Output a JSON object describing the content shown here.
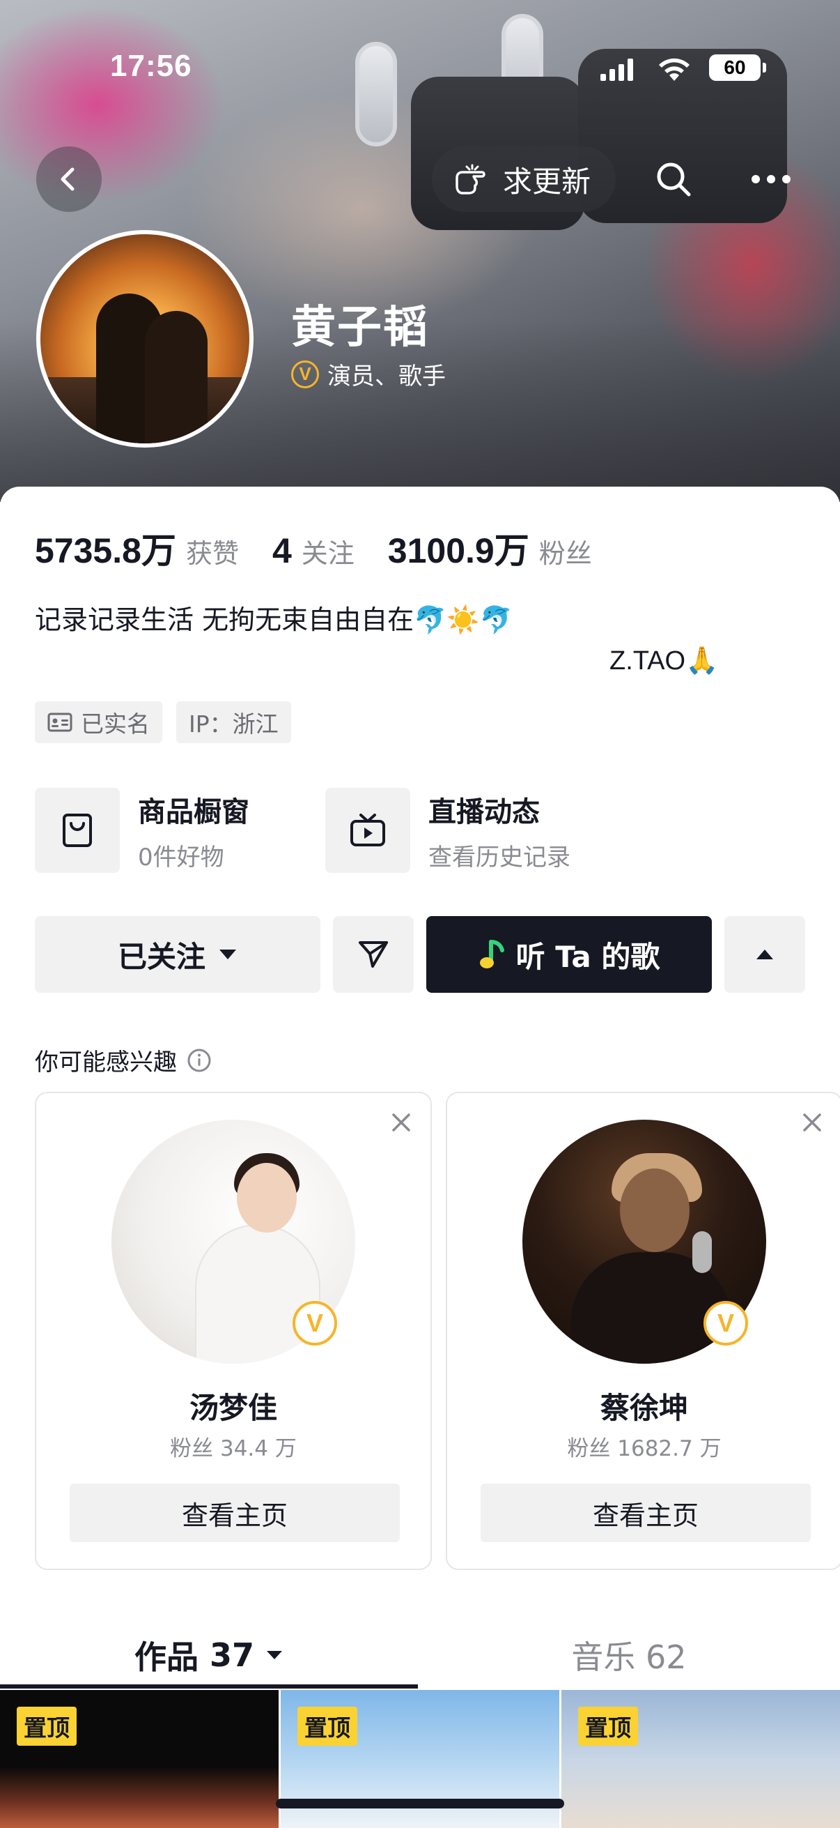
{
  "status_bar": {
    "time": "17:56",
    "battery": "60"
  },
  "header": {
    "back_icon": "chevron-left-icon",
    "request_update_label": "求更新",
    "search_icon": "search-icon",
    "more_icon": "more-dots-icon"
  },
  "profile": {
    "name": "黄子韬",
    "verified_badge": "V",
    "verified_label": "演员、歌手",
    "badge_color": "#F5B52B"
  },
  "stats": {
    "likes_value": "5735.8万",
    "likes_label": "获赞",
    "following_value": "4",
    "following_label": "关注",
    "fans_value": "3100.9万",
    "fans_label": "粉丝"
  },
  "bio": {
    "line1": "记录记录生活 无拘无束自由自在🐬☀️🐬",
    "line2": "Z.TAO🙏"
  },
  "tags": {
    "realname": "已实名",
    "ip": "IP：浙江"
  },
  "entries": {
    "shop_title": "商品橱窗",
    "shop_sub": "0件好物",
    "live_title": "直播动态",
    "live_sub": "查看历史记录"
  },
  "actions": {
    "following_label": "已关注",
    "music_label": "听 Ta 的歌"
  },
  "suggestions": {
    "title": "你可能感兴趣",
    "cards": [
      {
        "name": "汤梦佳",
        "fans": "粉丝 34.4 万",
        "button": "查看主页",
        "badge": "V"
      },
      {
        "name": "蔡徐坤",
        "fans": "粉丝 1682.7 万",
        "button": "查看主页",
        "badge": "V"
      }
    ]
  },
  "tabs": {
    "works_label": "作品",
    "works_count": "37",
    "music_label": "音乐 62"
  },
  "thumbnails": [
    {
      "tag": "置顶"
    },
    {
      "tag": "置顶"
    },
    {
      "tag": "置顶"
    }
  ]
}
